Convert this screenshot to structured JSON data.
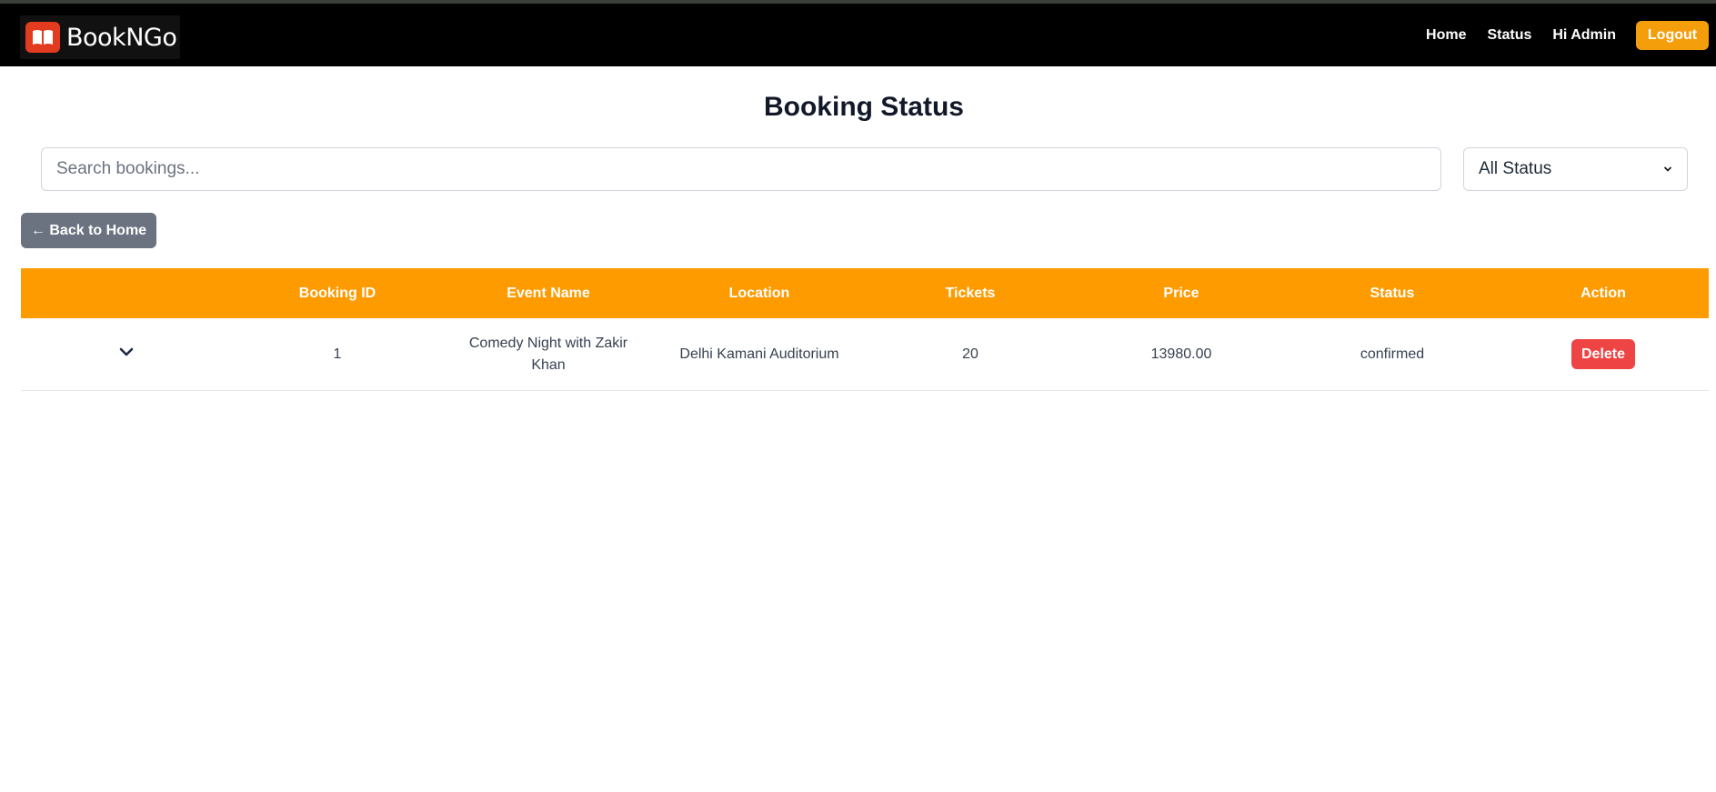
{
  "brand": {
    "name": "BookNGo",
    "icon": "ticket-book-icon"
  },
  "nav": {
    "home": "Home",
    "status": "Status",
    "greeting": "Hi Admin",
    "logout": "Logout"
  },
  "page": {
    "title": "Booking Status"
  },
  "search": {
    "placeholder": "Search bookings...",
    "value": ""
  },
  "filter": {
    "selected": "All Status"
  },
  "back_button": {
    "label": "← Back to Home"
  },
  "table": {
    "headers": [
      "",
      "Booking ID",
      "Event Name",
      "Location",
      "Tickets",
      "Price",
      "Status",
      "Action"
    ],
    "rows": [
      {
        "booking_id": "1",
        "event_name": "Comedy Night with Zakir Khan",
        "location": "Delhi Kamani Auditorium",
        "tickets": "20",
        "price": "13980.00",
        "status": "confirmed",
        "action": "Delete"
      }
    ]
  },
  "colors": {
    "navbar": "#000000",
    "accent": "#fe9b00",
    "logout": "#f59e0b",
    "delete": "#ef4444",
    "back": "#6b7280"
  }
}
